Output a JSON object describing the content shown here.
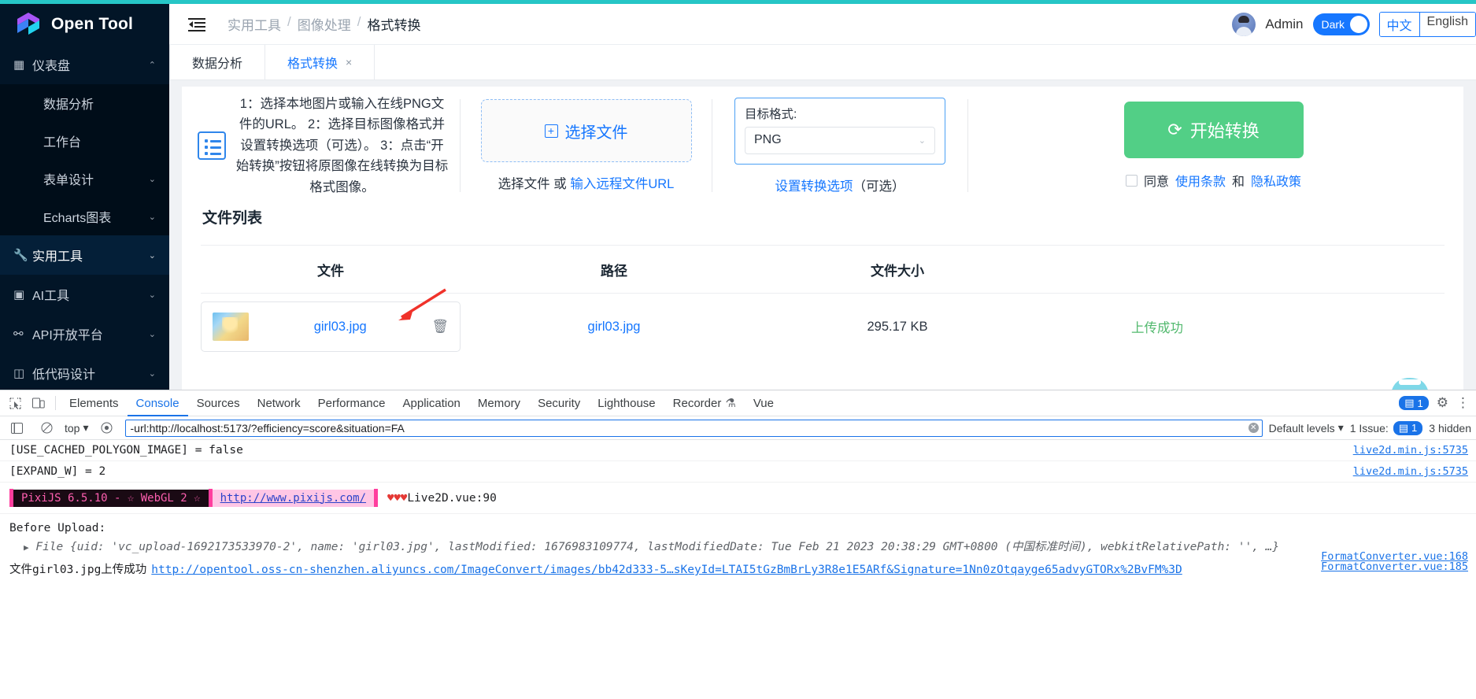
{
  "brand": {
    "name": "Open Tool"
  },
  "sidebar": {
    "items": [
      {
        "icon": "grid-icon",
        "label": "仪表盘",
        "chev": "⌃",
        "type": "group-open"
      },
      {
        "icon": "",
        "label": "数据分析",
        "chev": "",
        "type": "sub"
      },
      {
        "icon": "",
        "label": "工作台",
        "chev": "",
        "type": "sub"
      },
      {
        "icon": "",
        "label": "表单设计",
        "chev": "⌄",
        "type": "sub"
      },
      {
        "icon": "",
        "label": "Echarts图表",
        "chev": "⌄",
        "type": "sub"
      },
      {
        "icon": "wrench-icon",
        "label": "实用工具",
        "chev": "⌄",
        "type": "active"
      },
      {
        "icon": "robot-icon",
        "label": "AI工具",
        "chev": "⌄",
        "type": "item"
      },
      {
        "icon": "api-icon",
        "label": "API开放平台",
        "chev": "⌄",
        "type": "item"
      },
      {
        "icon": "code-icon",
        "label": "低代码设计",
        "chev": "⌄",
        "type": "item"
      }
    ]
  },
  "header": {
    "collapse_icon": "collapse-sidebar-icon",
    "breadcrumb": [
      "实用工具",
      "图像处理",
      "格式转换"
    ],
    "admin_label": "Admin",
    "dark_label": "Dark",
    "lang_cn": "中文",
    "lang_en": "English"
  },
  "tabs": [
    {
      "label": "数据分析",
      "active": false,
      "closable": false
    },
    {
      "label": "格式转换",
      "active": true,
      "closable": true,
      "close": "×"
    }
  ],
  "panel": {
    "instructions": "1：选择本地图片或输入在线PNG文件的URL。 2：选择目标图像格式并设置转换选项（可选）。 3：点击“开始转换”按钮将原图像在线转换为目标格式图像。",
    "select_file_btn": "选择文件",
    "under_zone_prefix": "选择文件 或 ",
    "under_zone_link": "输入远程文件URL",
    "format_label": "目标格式:",
    "format_value": "PNG",
    "format_options_link": "设置转换选项",
    "format_options_suffix": "（可选）",
    "start_btn": "开始转换",
    "agree_prefix": "同意",
    "agree_terms": "使用条款",
    "agree_and": "和",
    "agree_privacy": "隐私政策"
  },
  "file_list": {
    "title": "文件列表",
    "columns": [
      "文件",
      "路径",
      "文件大小",
      ""
    ],
    "rows": [
      {
        "file_name": "girl03.jpg",
        "path": "girl03.jpg",
        "size": "295.17 KB",
        "status": "上传成功",
        "delete_icon": "trash-icon"
      }
    ]
  },
  "devtools": {
    "tabs": [
      "Elements",
      "Console",
      "Sources",
      "Network",
      "Performance",
      "Application",
      "Memory",
      "Security",
      "Lighthouse",
      "Recorder",
      "Vue"
    ],
    "active_tab": "Console",
    "recorder_suffix": "⚗",
    "messages_badge": "1",
    "context": "top",
    "filter_value": "-url:http://localhost:5173/?efficiency=score&situation=FA",
    "default_levels": "Default levels",
    "issues": "1 Issue:",
    "issues_count": "1",
    "hidden": "3 hidden",
    "lines": [
      {
        "text": "[USE_CACHED_POLYGON_IMAGE] = false",
        "source": "live2d.min.js:5735"
      },
      {
        "text": "[EXPAND_W] = 2",
        "source": "live2d.min.js:5735"
      }
    ],
    "pixi": {
      "dark_text": "PixiJS 6.5.10 - ☆ WebGL 2 ☆",
      "link": "http://www.pixijs.com/",
      "hearts": "♥♥♥",
      "source": "Live2D.vue:90"
    },
    "before_upload": {
      "title": "Before Upload:",
      "line": "File {uid: 'vc_upload-1692173533970-2', name: 'girl03.jpg', lastModified: 1676983109774, lastModifiedDate: Tue Feb 21 2023 20:38:29 GMT+0800 (中国标准时间), webkitRelativePath: '', …}",
      "source": "FormatConverter.vue:168"
    },
    "upload_success": {
      "text": "文件girl03.jpg上传成功",
      "url": "http://opentool.oss-cn-shenzhen.aliyuncs.com/ImageConvert/images/bb42d333-5…sKeyId=LTAI5tGzBmBrLy3R8e1E5ARf&Signature=1Nn0zOtqayge65advyGTORx%2BvFM%3D",
      "source": "FormatConverter.vue:185"
    }
  },
  "colors": {
    "accent_teal": "#26c6c6",
    "sidebar_bg": "#021527",
    "primary_blue": "#1677ff",
    "success_green": "#52cf86",
    "devtools_blue": "#1a73e8"
  }
}
